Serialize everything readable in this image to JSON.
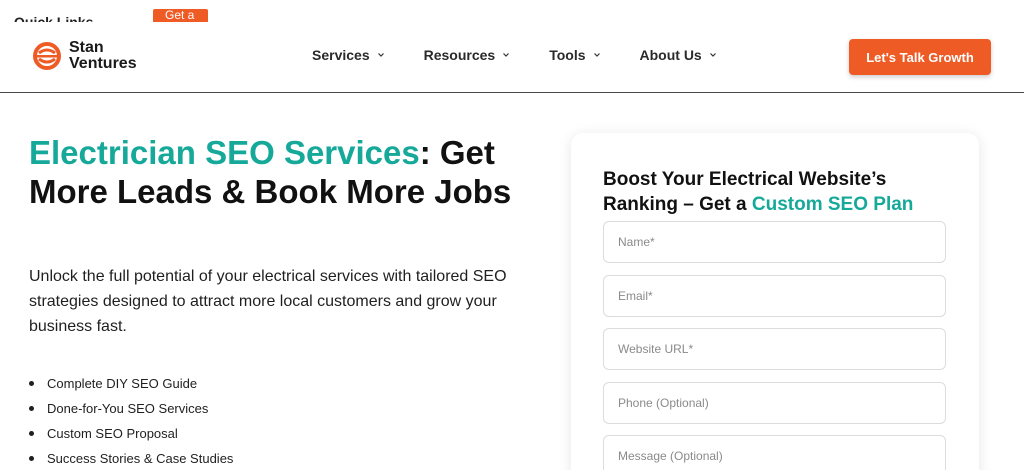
{
  "topbar": {
    "quick_links": "Quick Links",
    "get_a": "Get a"
  },
  "logo": {
    "line1": "Stan",
    "line2": "Ventures"
  },
  "nav": {
    "items": [
      {
        "label": "Services"
      },
      {
        "label": "Resources"
      },
      {
        "label": "Tools"
      },
      {
        "label": "About Us"
      }
    ],
    "cta_label": "Let's Talk Growth"
  },
  "hero": {
    "title_highlight": "Electrician SEO Services",
    "title_rest": ": Get More Leads & Book More Jobs",
    "description": "Unlock the full potential of your electrical services with tailored SEO strategies designed to attract more local customers and grow your business fast.",
    "features": [
      "Complete DIY SEO Guide",
      "Done-for-You SEO Services",
      "Custom SEO Proposal",
      "Success Stories & Case Studies"
    ]
  },
  "form": {
    "title_prefix": "Boost Your Electrical Website’s Ranking – Get a ",
    "title_highlight": "Custom SEO Plan",
    "name_placeholder": "Name*",
    "email_placeholder": "Email*",
    "website_placeholder": "Website URL*",
    "phone_placeholder": "Phone (Optional)",
    "message_placeholder": "Message (Optional)"
  },
  "colors": {
    "brand_orange": "#ef5b25",
    "accent_teal": "#16a99a",
    "text_dark": "#111111"
  },
  "icons": {
    "logo": "stan-ventures-logo-icon",
    "chevron": "chevron-down-icon"
  }
}
